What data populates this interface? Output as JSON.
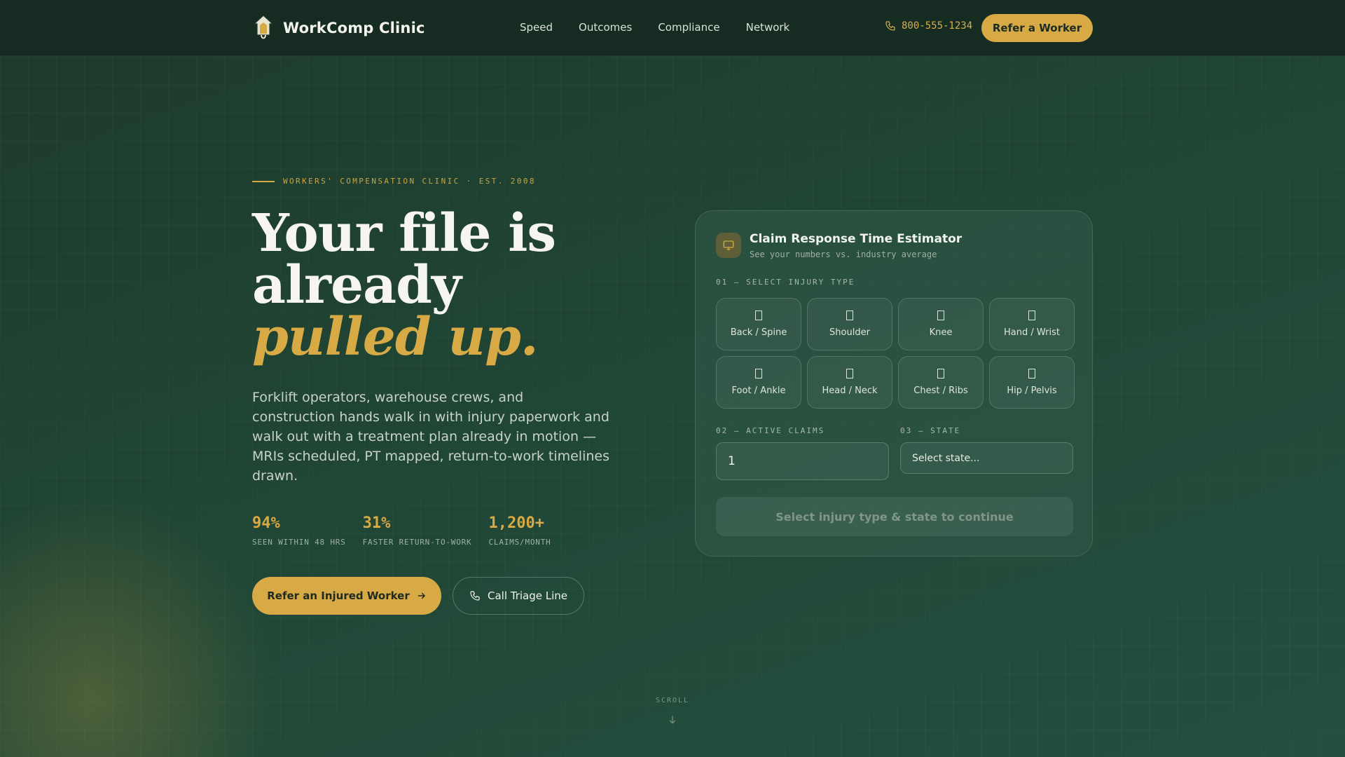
{
  "colors": {
    "accent": "#d8aa45",
    "nav_bg": "#162c22",
    "page_bg": "#204534"
  },
  "nav": {
    "brand": "WorkComp Clinic",
    "links": [
      "Speed",
      "Outcomes",
      "Compliance",
      "Network"
    ],
    "phone": "800-555-1234",
    "cta": "Refer a Worker"
  },
  "hero": {
    "eyebrow": "WORKERS' COMPENSATION CLINIC · EST. 2008",
    "headline_line1": "Your file is",
    "headline_line2": "already",
    "headline_accent": "pulled up.",
    "lead": "Forklift operators, warehouse crews, and construction hands walk in with injury paperwork and walk out with a treatment plan already in motion — MRIs scheduled, PT mapped, return-to-work timelines drawn.",
    "stats": [
      {
        "value": "94%",
        "label": "SEEN WITHIN 48 HRS"
      },
      {
        "value": "31%",
        "label": "FASTER RETURN-TO-WORK"
      },
      {
        "value": "1,200+",
        "label": "CLAIMS/MONTH"
      }
    ],
    "primary_cta": "Refer an Injured Worker",
    "secondary_cta": "Call Triage Line"
  },
  "estimator": {
    "title": "Claim Response Time Estimator",
    "subtitle": "See your numbers vs. industry average",
    "step1_label": "01 — SELECT INJURY TYPE",
    "injury_types": [
      "Back / Spine",
      "Shoulder",
      "Knee",
      "Hand / Wrist",
      "Foot / Ankle",
      "Head / Neck",
      "Chest / Ribs",
      "Hip / Pelvis"
    ],
    "step2_label": "02 — ACTIVE CLAIMS",
    "active_claims_value": "1",
    "step3_label": "03 — STATE",
    "state_placeholder": "Select state...",
    "submit_label": "Select injury type & state to continue"
  },
  "scroll_label": "SCROLL"
}
